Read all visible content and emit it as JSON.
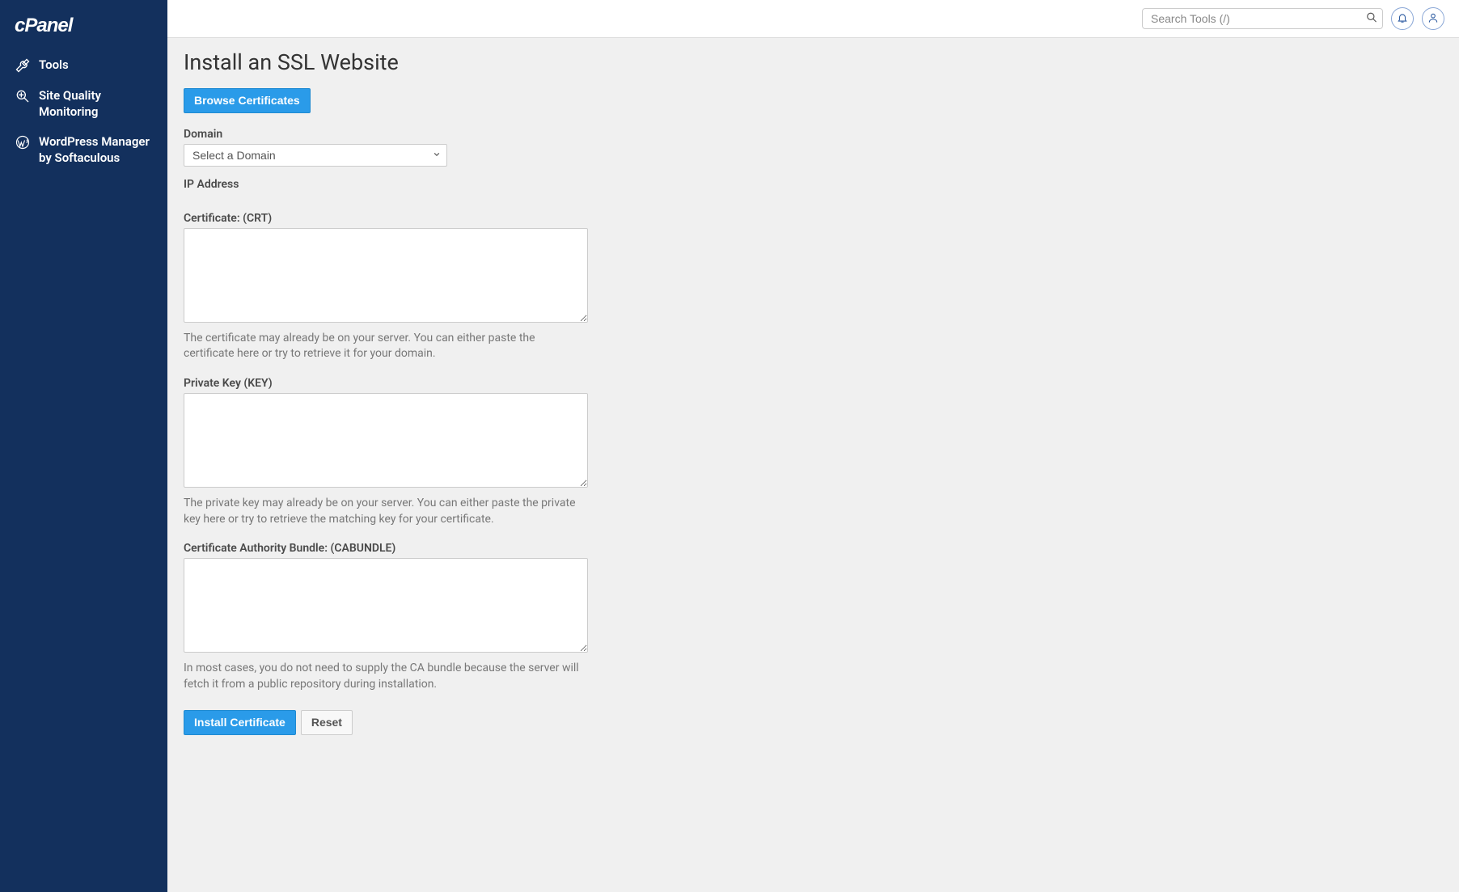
{
  "sidebar": {
    "items": [
      {
        "label": "Tools"
      },
      {
        "label": "Site Quality Monitoring"
      },
      {
        "label": "WordPress Manager by Softaculous"
      }
    ]
  },
  "header": {
    "search_placeholder": "Search Tools (/)"
  },
  "page": {
    "title": "Install an SSL Website",
    "browse_button": "Browse Certificates",
    "domain_label": "Domain",
    "domain_placeholder": "Select a Domain",
    "ip_label": "IP Address",
    "ip_value": "",
    "crt_label": "Certificate: (CRT)",
    "crt_help": "The certificate may already be on your server. You can either paste the certificate here or try to retrieve it for your domain.",
    "key_label": "Private Key (KEY)",
    "key_help": "The private key may already be on your server. You can either paste the private key here or try to retrieve the matching key for your certificate.",
    "cabundle_label": "Certificate Authority Bundle: (CABUNDLE)",
    "cabundle_help": "In most cases, you do not need to supply the CA bundle because the server will fetch it from a public repository during installation.",
    "install_button": "Install Certificate",
    "reset_button": "Reset"
  }
}
